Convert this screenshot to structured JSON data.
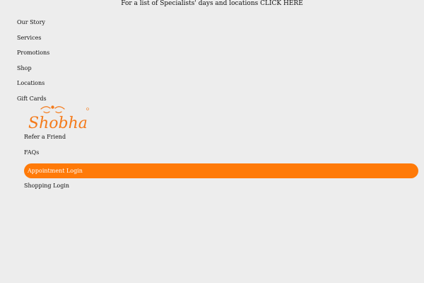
{
  "announcement": {
    "text": "For a list of Specialists' days and locations",
    "link": "CLICK HERE"
  },
  "nav_primary": [
    {
      "label": "Our Story"
    },
    {
      "label": "Services"
    },
    {
      "label": "Promotions"
    },
    {
      "label": "Shop"
    },
    {
      "label": "Locations"
    },
    {
      "label": "Gift Cards"
    }
  ],
  "logo": {
    "wordmark": "Shobha",
    "icon": "shobha-logo-icon",
    "accent_color": "#f47a1a"
  },
  "nav_secondary": [
    {
      "label": "Refer a Friend"
    },
    {
      "label": "FAQs"
    }
  ],
  "appointment_login": {
    "label": "Appointment Login",
    "color": "#ff7a08"
  },
  "shopping_login": {
    "label": "Shopping Login"
  },
  "colors": {
    "background": "#ededed",
    "text": "#111111"
  }
}
